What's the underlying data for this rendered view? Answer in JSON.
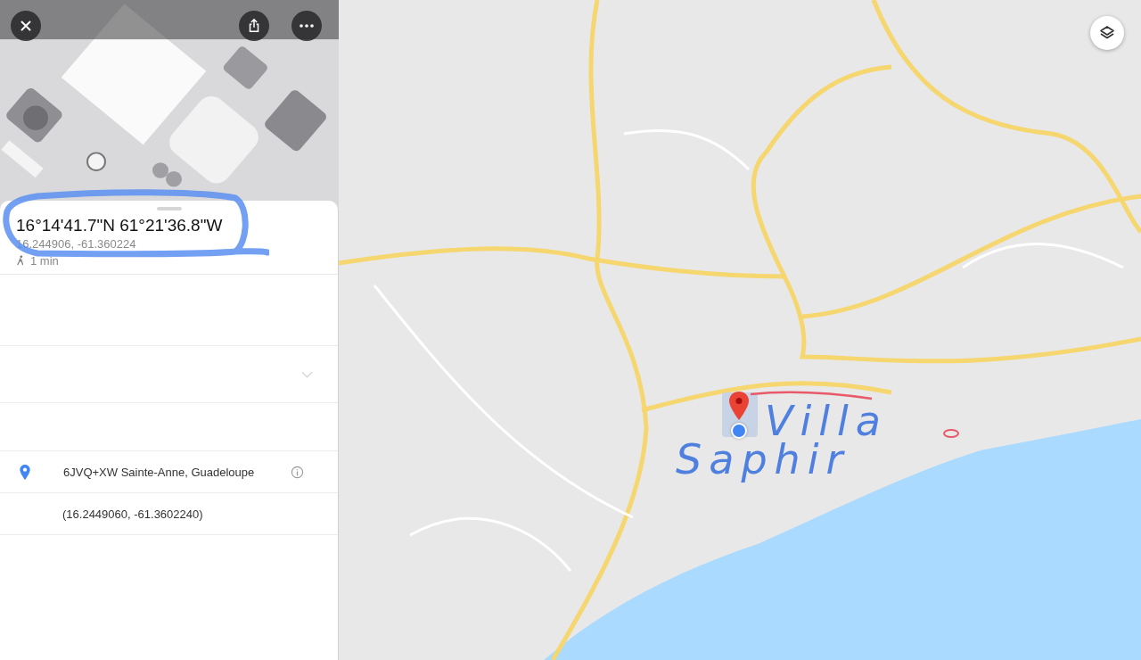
{
  "place_panel": {
    "title": "16°14'41.7\"N 61°21'36.8\"W",
    "subtitle": "16.244906, -61.360224",
    "travel_time": "1 min",
    "details": [
      {
        "kind": "empty"
      },
      {
        "kind": "collapsed"
      },
      {
        "kind": "empty"
      },
      {
        "kind": "plus_code",
        "text": "6JVQ+XW Sainte-Anne, Guadeloupe"
      },
      {
        "kind": "coordinates",
        "text": "(16.2449060, -61.3602240)"
      }
    ]
  },
  "annotations": [
    {
      "text": "Villa"
    },
    {
      "text": "Saphir"
    }
  ]
}
